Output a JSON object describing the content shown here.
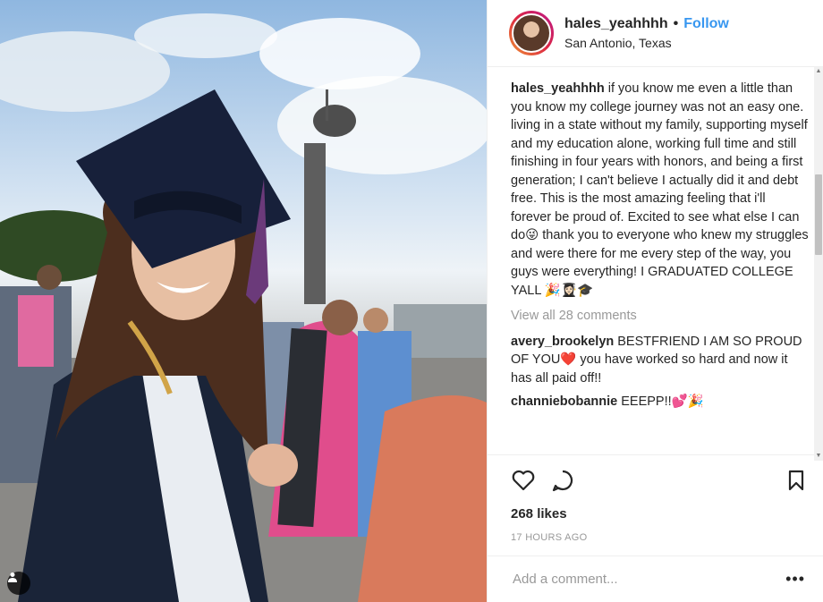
{
  "post": {
    "username": "hales_yeahhhh",
    "separator": "•",
    "follow_label": "Follow",
    "location": "San Antonio, Texas"
  },
  "caption": {
    "username": "hales_yeahhhh",
    "text": "if you know me even a little than you know my college journey was not an easy one. living in a state without my family, supporting myself and my education alone, working full time and still finishing in four years with honors, and being a first generation; I can't believe I actually did it and debt free. This is the most amazing feeling that i'll forever be proud of. Excited to see what else I can do😜 thank you to everyone who knew my struggles and were there for me every step of the way, you guys were everything! I GRADUATED COLLEGE YALL 🎉👩🏻‍🎓🎓"
  },
  "view_all_comments": "View all 28 comments",
  "comments": [
    {
      "username": "avery_brookelyn",
      "text": "BESTFRIEND I AM SO PROUD OF YOU❤️ you have worked so hard and now it has all paid off!!"
    },
    {
      "username": "channiebobannie",
      "text": "EEEPP!!💕🎉"
    }
  ],
  "likes": "268 likes",
  "time_ago": "17 HOURS AGO",
  "add_comment_placeholder": "Add a comment...",
  "more_label": "•••",
  "icons": {
    "like": "heart-icon",
    "comment": "comment-bubble-icon",
    "save": "bookmark-icon",
    "user_tag": "user-tag-icon"
  },
  "colors": {
    "accent": "#3897f0",
    "text": "#262626",
    "muted": "#999999",
    "border": "#efefef"
  }
}
